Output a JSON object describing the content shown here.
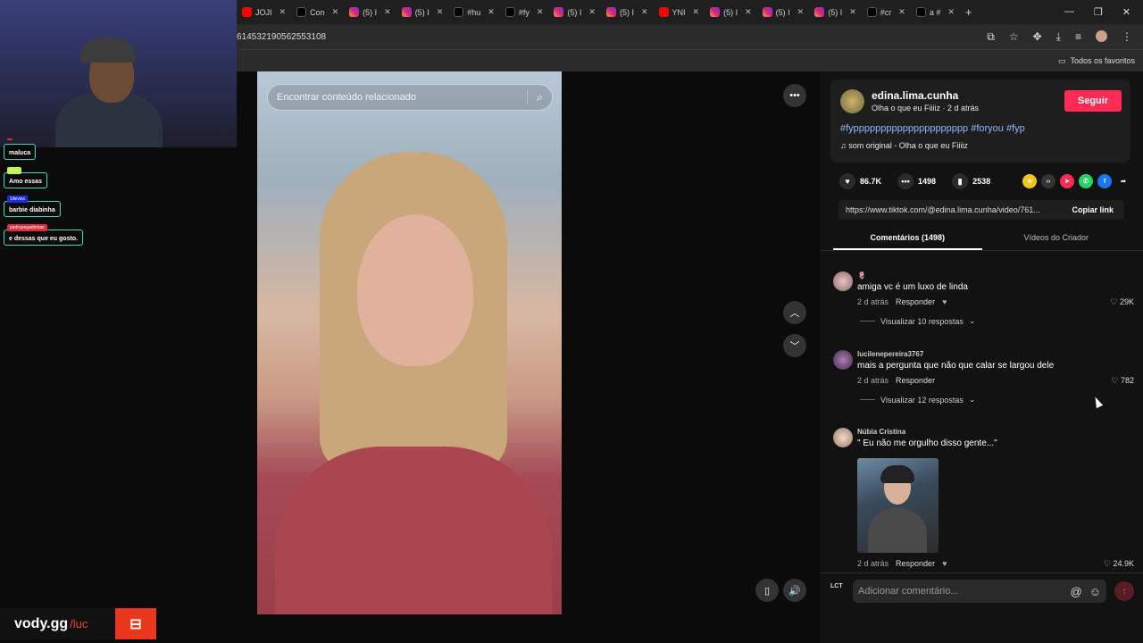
{
  "browser": {
    "tabs": [
      {
        "label": "JOJI",
        "type": "yt"
      },
      {
        "label": "Con",
        "type": "tt"
      },
      {
        "label": "(5) I",
        "type": "ig"
      },
      {
        "label": "(5) I",
        "type": "ig"
      },
      {
        "label": "#hu",
        "type": "tt"
      },
      {
        "label": "#fy",
        "type": "tt"
      },
      {
        "label": "(5) I",
        "type": "ig"
      },
      {
        "label": "(5) I",
        "type": "ig"
      },
      {
        "label": "YNI",
        "type": "yt"
      },
      {
        "label": "(5) I",
        "type": "ig"
      },
      {
        "label": "(5) I",
        "type": "ig"
      },
      {
        "label": "(5) I",
        "type": "ig"
      },
      {
        "label": "#cr",
        "type": "tt"
      },
      {
        "label": "a #",
        "type": "tt"
      }
    ],
    "url": "614532190562553108",
    "favorites_label": "Todos os favoritos"
  },
  "stream": {
    "chat": [
      {
        "user": "",
        "user_color": "#e02d3c",
        "text": "maluca"
      },
      {
        "user": "✓ ✓",
        "user_color": "#c8f24a",
        "text": "Amo essas"
      },
      {
        "user": "1devisx",
        "user_color": "#1a2fe0",
        "text": "barbie diabinha"
      },
      {
        "user": "pedropegadinhas",
        "user_color": "#e02d3c",
        "text": "e dessas que eu gosto."
      }
    ],
    "brand": "vody.gg",
    "brand_sub": "/luc"
  },
  "video": {
    "search_placeholder": "Encontrar conteúdo relacionado"
  },
  "creator": {
    "username": "edina.lima.cunha",
    "subtitle": "Olha o que eu Fiiiiz · 2 d atrás",
    "follow_label": "Seguir",
    "hashtags": "#fyppppppppppppppppppppp #foryou #fyp",
    "sound": "som original - Olha o que eu Fiiiiz"
  },
  "stats": {
    "likes": "86.7K",
    "comments": "1498",
    "saves": "2538"
  },
  "share": {
    "link": "https://www.tiktok.com/@edina.lima.cunha/video/761...",
    "copy_label": "Copiar link"
  },
  "comment_tabs": {
    "comments": "Comentários (1498)",
    "creator_videos": "Vídeos do Criador"
  },
  "comments": [
    {
      "user": "🌷",
      "text": "amiga vc é um luxo de linda",
      "time": "2 d atrás",
      "reply": "Responder",
      "likes": "29K",
      "replies": "Visualizar 10 respostas"
    },
    {
      "user": "lucilenepereira3767",
      "text": "mais a pergunta que não que calar se largou dele",
      "time": "2 d atrás",
      "reply": "Responder",
      "likes": "782",
      "replies": "Visualizar 12 respostas"
    },
    {
      "user": "Núbia Cristina",
      "text": "\" Eu não me orgulho disso gente...\"",
      "time": "2 d atrás",
      "reply": "Responder",
      "likes": "24.9K"
    }
  ],
  "comment_input": {
    "placeholder": "Adicionar comentário...",
    "logo": "LCT"
  }
}
